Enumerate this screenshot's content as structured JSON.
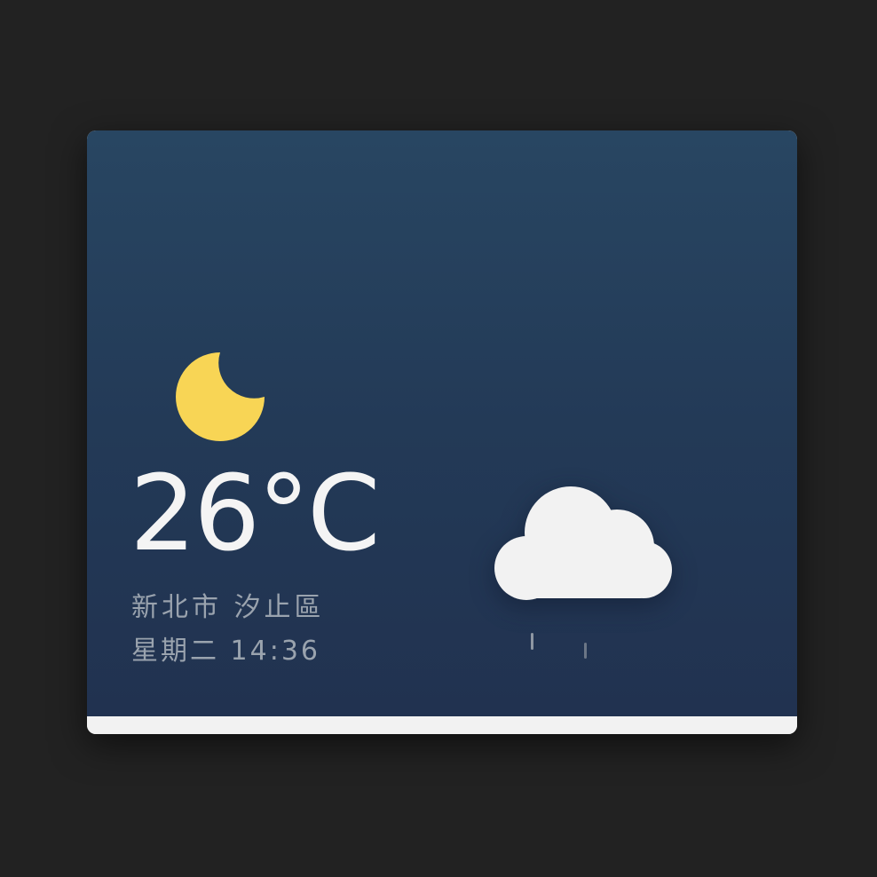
{
  "weather": {
    "temperature": "26°C",
    "location": "新北市 汐止區",
    "datetime": "星期二 14:36",
    "current_icon": "moon-icon",
    "forecast_icon": "cloud-rain-icon"
  },
  "colors": {
    "background": "#222222",
    "panel_top": "#284662",
    "panel_bottom": "#213250",
    "moon": "#f8d555",
    "cloud": "#f2f2f2",
    "text_primary": "#f4f4f4",
    "text_secondary": "#9aa3ae"
  }
}
